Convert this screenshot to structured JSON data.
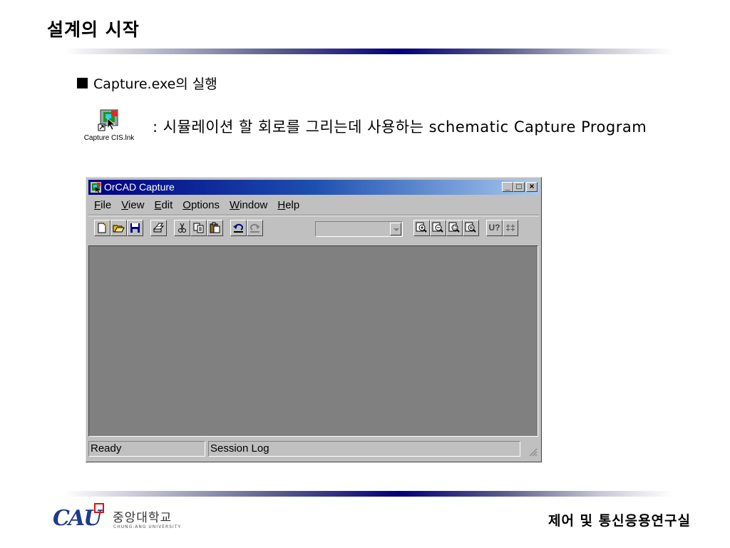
{
  "slide": {
    "title": "설계의 시작",
    "bullet": "Capture.exe의 실행",
    "shortcut_label": "Capture CIS.lnk",
    "description": ": 시뮬레이션 할 회로를 그리는데 사용하는 schematic Capture Program",
    "lab_name": "제어 및 통신응용연구실",
    "logo_mark": "CAU",
    "logo_name": "중앙대학교",
    "logo_sub": "CHUNG-ANG UNIVERSITY"
  },
  "window": {
    "title": "OrCAD Capture",
    "caption_buttons": [
      "_",
      "□",
      "×"
    ],
    "menu": [
      {
        "key": "F",
        "rest": "ile"
      },
      {
        "key": "V",
        "rest": "iew"
      },
      {
        "key": "E",
        "rest": "dit"
      },
      {
        "key": "O",
        "rest": "ptions"
      },
      {
        "key": "W",
        "rest": "indow"
      },
      {
        "key": "H",
        "rest": "elp"
      }
    ],
    "toolbar_icons": [
      "new-icon",
      "open-icon",
      "save-icon",
      "print-icon",
      "cut-icon",
      "copy-icon",
      "paste-icon",
      "undo-icon",
      "redo-icon",
      "zoom-in-icon",
      "zoom-out-icon",
      "zoom-area-icon",
      "zoom-all-icon",
      "annotate-icon",
      "back-annotate-icon"
    ],
    "toolbar_text": {
      "annotate": "U?",
      "back_annotate": "‡‡"
    },
    "status": {
      "ready": "Ready",
      "session_log": "Session Log"
    }
  },
  "colors": {
    "title_bar": "#000080",
    "workspace": "#808080",
    "rule_center": "#00007a",
    "logo_blue": "#1f3a8a"
  }
}
